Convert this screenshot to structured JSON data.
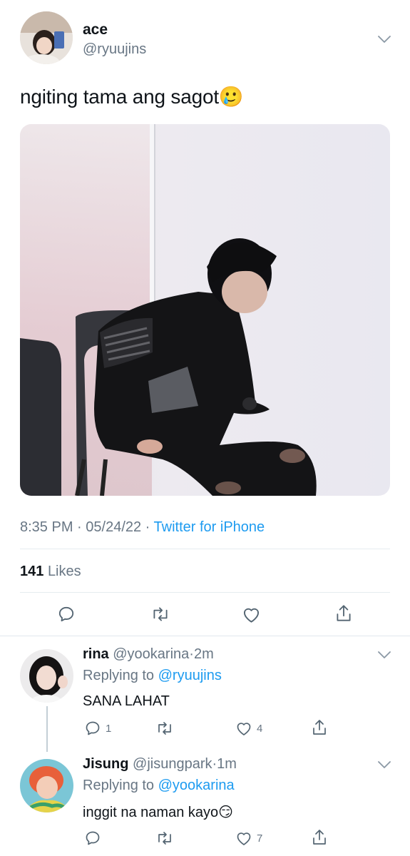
{
  "tweet": {
    "author_name": "ace",
    "author_handle": "@ryuujins",
    "text": "ngiting tama ang sagot🥲",
    "time": "8:35 PM",
    "date": "05/24/22",
    "source": "Twitter for iPhone",
    "likes_count": "141",
    "likes_label": "Likes",
    "menu_icon": "chevron-down-icon"
  },
  "replies": [
    {
      "name": "rina",
      "handle": "@yookarina",
      "age": "2m",
      "replying_to_label": "Replying to",
      "replying_to_handle": "@ryuujins",
      "text": "SANA LAHAT",
      "reply_count": "1",
      "retweet_count": "",
      "like_count": "4"
    },
    {
      "name": "Jisung",
      "handle": "@jisungpark",
      "age": "1m",
      "replying_to_label": "Replying to",
      "replying_to_handle": "@yookarina",
      "text": "inggit na naman kayo😏",
      "reply_count": "",
      "retweet_count": "",
      "like_count": "7"
    }
  ],
  "colors": {
    "link": "#1d9bf0",
    "muted": "#687684",
    "divider": "#e6ecf0"
  }
}
